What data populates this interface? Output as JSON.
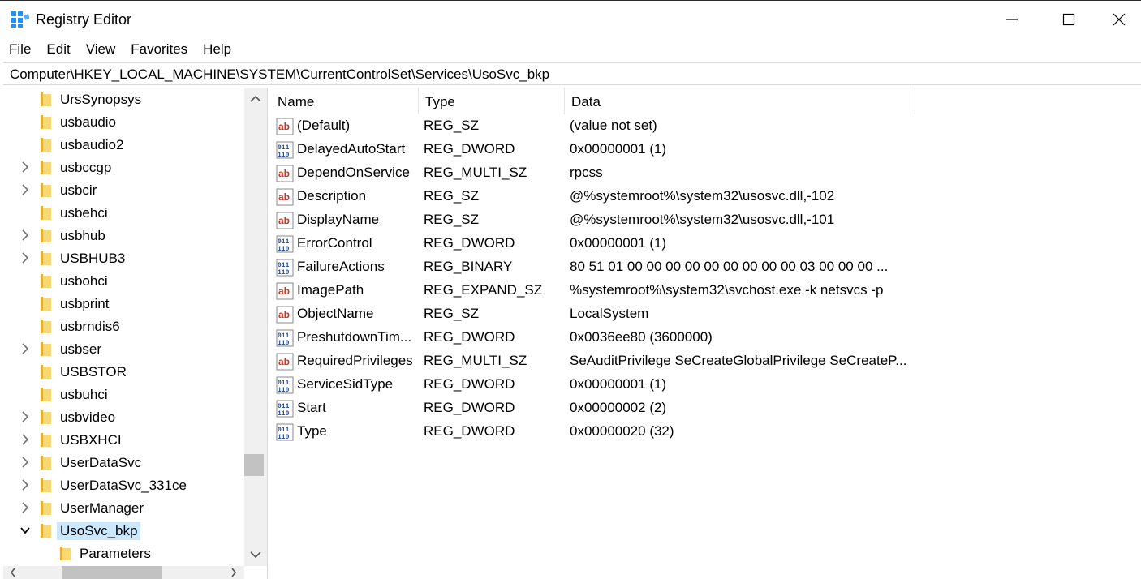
{
  "window": {
    "title": "Registry Editor"
  },
  "menu": [
    "File",
    "Edit",
    "View",
    "Favorites",
    "Help"
  ],
  "address": "Computer\\HKEY_LOCAL_MACHINE\\SYSTEM\\CurrentControlSet\\Services\\UsoSvc_bkp",
  "tree": {
    "items": [
      {
        "label": "UrsSynopsys",
        "expandable": false,
        "level": 1
      },
      {
        "label": "usbaudio",
        "expandable": false,
        "level": 1
      },
      {
        "label": "usbaudio2",
        "expandable": false,
        "level": 1
      },
      {
        "label": "usbccgp",
        "expandable": true,
        "level": 1
      },
      {
        "label": "usbcir",
        "expandable": true,
        "level": 1
      },
      {
        "label": "usbehci",
        "expandable": false,
        "level": 1
      },
      {
        "label": "usbhub",
        "expandable": true,
        "level": 1
      },
      {
        "label": "USBHUB3",
        "expandable": true,
        "level": 1
      },
      {
        "label": "usbohci",
        "expandable": false,
        "level": 1
      },
      {
        "label": "usbprint",
        "expandable": false,
        "level": 1
      },
      {
        "label": "usbrndis6",
        "expandable": false,
        "level": 1
      },
      {
        "label": "usbser",
        "expandable": true,
        "level": 1
      },
      {
        "label": "USBSTOR",
        "expandable": false,
        "level": 1
      },
      {
        "label": "usbuhci",
        "expandable": false,
        "level": 1
      },
      {
        "label": "usbvideo",
        "expandable": true,
        "level": 1
      },
      {
        "label": "USBXHCI",
        "expandable": true,
        "level": 1
      },
      {
        "label": "UserDataSvc",
        "expandable": true,
        "level": 1
      },
      {
        "label": "UserDataSvc_331ce",
        "expandable": true,
        "level": 1
      },
      {
        "label": "UserManager",
        "expandable": true,
        "level": 1
      },
      {
        "label": "UsoSvc_bkp",
        "expandable": true,
        "expanded": true,
        "selected": true,
        "level": 1
      },
      {
        "label": "Parameters",
        "expandable": false,
        "level": 2
      }
    ]
  },
  "columns": {
    "name": "Name",
    "type": "Type",
    "data": "Data"
  },
  "values": [
    {
      "name": "(Default)",
      "type": "REG_SZ",
      "data": "(value not set)",
      "icon": "string-value-icon"
    },
    {
      "name": "DelayedAutoStart",
      "type": "REG_DWORD",
      "data": "0x00000001 (1)",
      "icon": "binary-value-icon"
    },
    {
      "name": "DependOnService",
      "type": "REG_MULTI_SZ",
      "data": "rpcss",
      "icon": "string-value-icon"
    },
    {
      "name": "Description",
      "type": "REG_SZ",
      "data": "@%systemroot%\\system32\\usosvc.dll,-102",
      "icon": "string-value-icon"
    },
    {
      "name": "DisplayName",
      "type": "REG_SZ",
      "data": "@%systemroot%\\system32\\usosvc.dll,-101",
      "icon": "string-value-icon"
    },
    {
      "name": "ErrorControl",
      "type": "REG_DWORD",
      "data": "0x00000001 (1)",
      "icon": "binary-value-icon"
    },
    {
      "name": "FailureActions",
      "type": "REG_BINARY",
      "data": "80 51 01 00 00 00 00 00 00 00 00 00 03 00 00 00 ...",
      "icon": "binary-value-icon"
    },
    {
      "name": "ImagePath",
      "type": "REG_EXPAND_SZ",
      "data": "%systemroot%\\system32\\svchost.exe -k netsvcs -p",
      "icon": "string-value-icon"
    },
    {
      "name": "ObjectName",
      "type": "REG_SZ",
      "data": "LocalSystem",
      "icon": "string-value-icon"
    },
    {
      "name": "PreshutdownTim...",
      "type": "REG_DWORD",
      "data": "0x0036ee80 (3600000)",
      "icon": "binary-value-icon"
    },
    {
      "name": "RequiredPrivileges",
      "type": "REG_MULTI_SZ",
      "data": "SeAuditPrivilege SeCreateGlobalPrivilege SeCreateP...",
      "icon": "string-value-icon"
    },
    {
      "name": "ServiceSidType",
      "type": "REG_DWORD",
      "data": "0x00000001 (1)",
      "icon": "binary-value-icon"
    },
    {
      "name": "Start",
      "type": "REG_DWORD",
      "data": "0x00000002 (2)",
      "icon": "binary-value-icon"
    },
    {
      "name": "Type",
      "type": "REG_DWORD",
      "data": "0x00000020 (32)",
      "icon": "binary-value-icon"
    }
  ],
  "colors": {
    "folder": "#f8d775",
    "selection": "#cce8ff",
    "string_icon": "#c0392b",
    "binary_icon": "#1f4fa0"
  }
}
